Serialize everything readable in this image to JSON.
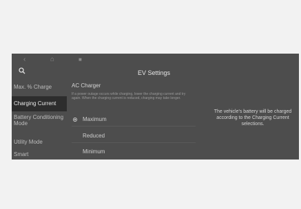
{
  "nav": {
    "back_icon": "chevron-left-icon",
    "home_icon": "home-icon",
    "menu_icon": "grid-icon"
  },
  "header": {
    "title": "EV Settings",
    "search_icon": "search-icon"
  },
  "sidebar": {
    "items": [
      {
        "label": "Max. % Charge"
      },
      {
        "label": "Charging Current",
        "active": true
      },
      {
        "label": "Battery Conditioning Mode"
      },
      {
        "label": "Utility Mode"
      },
      {
        "label": "Smart"
      }
    ]
  },
  "main": {
    "section_label": "AC Charger",
    "description": "If a power outage occurs while charging, lower the charging current and try again. When the charging current is reduced, charging may take longer.",
    "options": [
      {
        "label": "Maximum",
        "selected": true
      },
      {
        "label": "Reduced",
        "selected": false
      },
      {
        "label": "Minimum",
        "selected": false
      }
    ]
  },
  "info_text": "The vehicle's battery will be charged according to the Charging Current selections."
}
